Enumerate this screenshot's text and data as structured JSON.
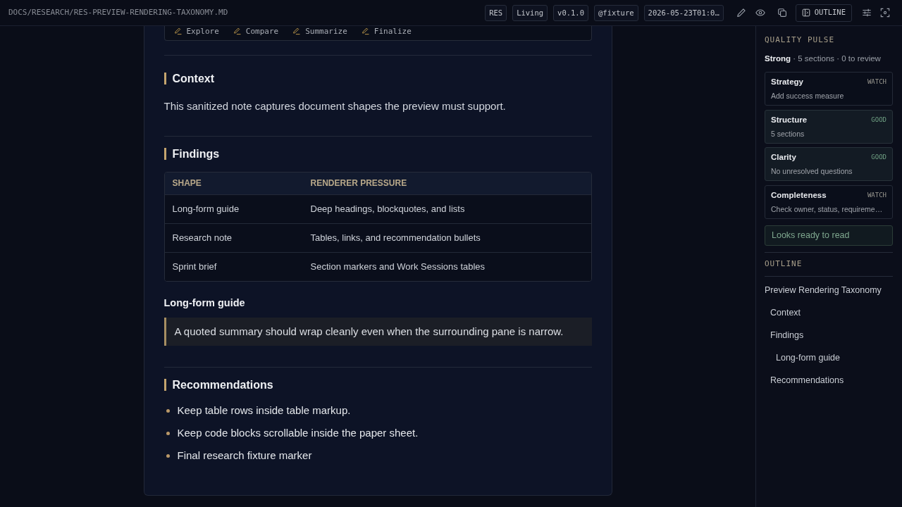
{
  "top_bar": {
    "path": "DOCS/RESEARCH/RES-PREVIEW-RENDERING-TAXONOMY.MD",
    "tags": [
      "RES",
      "Living",
      "v0.1.0",
      "@fixture",
      "2026-05-23T01:0…"
    ],
    "outline_button": "OUTLINE"
  },
  "document": {
    "actions": [
      "Explore",
      "Compare",
      "Summarize",
      "Finalize"
    ],
    "sections": [
      {
        "heading": "Context",
        "blocks": [
          {
            "kind": "paragraph",
            "text": "This sanitized note captures document shapes the preview must support."
          }
        ]
      },
      {
        "heading": "Findings",
        "blocks": [
          {
            "kind": "table",
            "columns": [
              "SHAPE",
              "RENDERER PRESSURE"
            ],
            "rows": [
              [
                "Long-form guide",
                "Deep headings, blockquotes, and lists"
              ],
              [
                "Research note",
                "Tables, links, and recommendation bullets"
              ],
              [
                "Sprint brief",
                "Section markers and Work Sessions tables"
              ]
            ]
          },
          {
            "kind": "subheading",
            "text": "Long-form guide"
          },
          {
            "kind": "quote",
            "text": "A quoted summary should wrap cleanly even when the surrounding pane is narrow."
          }
        ]
      },
      {
        "heading": "Recommendations",
        "blocks": [
          {
            "kind": "list",
            "items": [
              "Keep table rows inside table markup.",
              "Keep code blocks scrollable inside the paper sheet.",
              "Final research fixture marker"
            ]
          }
        ]
      }
    ]
  },
  "quality_pulse": {
    "title": "QUALITY PULSE",
    "summary": "**Strong** · 5 sections · 0 to review",
    "checks": [
      {
        "name": "Strategy",
        "status": "WATCH",
        "kind": "watch",
        "detail": "Add success measure"
      },
      {
        "name": "Structure",
        "status": "GOOD",
        "kind": "good",
        "detail": "5 sections"
      },
      {
        "name": "Clarity",
        "status": "GOOD",
        "kind": "good",
        "detail": "No unresolved questions"
      },
      {
        "name": "Completeness",
        "status": "WATCH",
        "kind": "watch",
        "detail": "Check owner, status, requireme…"
      }
    ],
    "verdict": "Looks ready to read"
  },
  "outline": {
    "title": "OUTLINE",
    "items": [
      {
        "label": "Preview Rendering Taxonomy",
        "children": [
          {
            "label": "Context"
          },
          {
            "label": "Findings",
            "children": [
              {
                "label": "Long-form guide"
              }
            ]
          },
          {
            "label": "Recommendations"
          }
        ]
      }
    ]
  }
}
